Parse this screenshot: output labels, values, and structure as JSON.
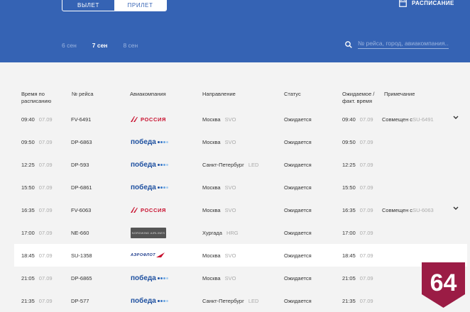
{
  "header": {
    "tabs": [
      "ВЫЛЕТ",
      "ПРИЛЕТ"
    ],
    "schedule_label": "РАСПИСАНИЕ",
    "dates": [
      "6 сен",
      "7 сен",
      "8 сен"
    ],
    "active_date": "7 сен",
    "search_placeholder": "№ рейса, город, авиакомпания..."
  },
  "columns": [
    "Время по расписанию",
    "№ рейса",
    "Авиакомпания",
    "Направление",
    "Статус",
    "Ожидаемое / факт. время",
    "Примечание"
  ],
  "flights": [
    {
      "time": "09:40",
      "date": "07.09",
      "flight": "FV-6491",
      "airline": "ross",
      "airline_text": "РОССИЯ",
      "city": "Москва",
      "code": "SVO",
      "status": "Ожидается",
      "etime": "09:40",
      "edate": "07.09",
      "note": "Совмещен с ",
      "note_code": "SU-6491",
      "expand": true
    },
    {
      "time": "09:50",
      "date": "07.09",
      "flight": "DP-6863",
      "airline": "pob",
      "airline_text": "победа",
      "city": "Москва",
      "code": "SVO",
      "status": "Ожидается",
      "etime": "09:50",
      "edate": "07.09",
      "note": "",
      "note_code": "",
      "expand": false
    },
    {
      "time": "12:25",
      "date": "07.09",
      "flight": "DP-593",
      "airline": "pob",
      "airline_text": "победа",
      "city": "Санкт-Петербург",
      "code": "LED",
      "status": "Ожидается",
      "etime": "12:25",
      "edate": "07.09",
      "note": "",
      "note_code": "",
      "expand": false
    },
    {
      "time": "15:50",
      "date": "07.09",
      "flight": "DP-6861",
      "airline": "pob",
      "airline_text": "победа",
      "city": "Москва",
      "code": "SVO",
      "status": "Ожидается",
      "etime": "15:50",
      "edate": "07.09",
      "note": "",
      "note_code": "",
      "expand": false
    },
    {
      "time": "16:35",
      "date": "07.09",
      "flight": "FV-6063",
      "airline": "ross",
      "airline_text": "РОССИЯ",
      "city": "Москва",
      "code": "SVO",
      "status": "Ожидается",
      "etime": "16:35",
      "edate": "07.09",
      "note": "Совмещен с ",
      "note_code": "SU-6063",
      "expand": true
    },
    {
      "time": "17:00",
      "date": "07.09",
      "flight": "NE-660",
      "airline": "nordwind",
      "airline_text": "NORDWIND AIRLINES",
      "city": "Хургада",
      "code": "HRG",
      "status": "Ожидается",
      "etime": "17:00",
      "edate": "07.09",
      "note": "",
      "note_code": "",
      "expand": false
    },
    {
      "time": "18:45",
      "date": "07.09",
      "flight": "SU-1358",
      "airline": "aero",
      "airline_text": "АЭРОФЛОТ",
      "city": "Москва",
      "code": "SVO",
      "status": "Ожидается",
      "etime": "18:45",
      "edate": "07.09",
      "note": "",
      "note_code": "",
      "expand": false
    },
    {
      "time": "21:05",
      "date": "07.09",
      "flight": "DP-6865",
      "airline": "pob",
      "airline_text": "победа",
      "city": "Москва",
      "code": "SVO",
      "status": "Ожидается",
      "etime": "21:05",
      "edate": "07.09",
      "note": "",
      "note_code": "",
      "expand": false
    },
    {
      "time": "21:35",
      "date": "07.09",
      "flight": "DP-577",
      "airline": "pob",
      "airline_text": "победа",
      "city": "Санкт-Петербург",
      "code": "LED",
      "status": "Ожидается",
      "etime": "21:35",
      "edate": "07.09",
      "note": "",
      "note_code": "",
      "expand": false
    }
  ],
  "badge": {
    "text": "64",
    "color": "#9b1c45"
  },
  "colors": {
    "header_bg": "#3563b4",
    "rossiya_red": "#c8102e",
    "pobeda_blue": "#1e50a0"
  }
}
